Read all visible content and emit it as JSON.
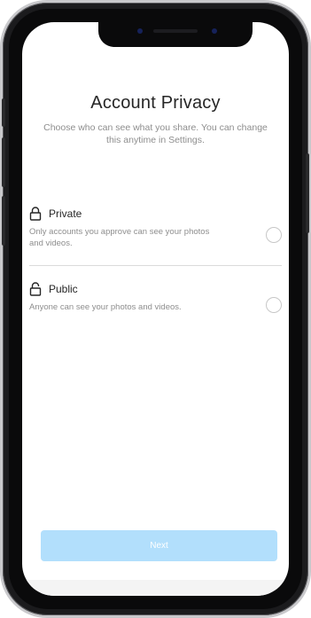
{
  "screen": {
    "title": "Account Privacy",
    "subtitle": "Choose who can see what you share. You can change this anytime in Settings."
  },
  "options": [
    {
      "icon": "lock-closed-icon",
      "label": "Private",
      "description": "Only accounts you approve can see your photos and videos.",
      "selected": false
    },
    {
      "icon": "lock-open-icon",
      "label": "Public",
      "description": "Anyone can see your photos and videos.",
      "selected": false
    }
  ],
  "footer": {
    "next_label": "Next",
    "next_disabled": true
  },
  "colors": {
    "primary_disabled": "#b2dffc",
    "text": "#262626",
    "secondary_text": "#8e8e8e",
    "divider": "#dbdbdb"
  }
}
